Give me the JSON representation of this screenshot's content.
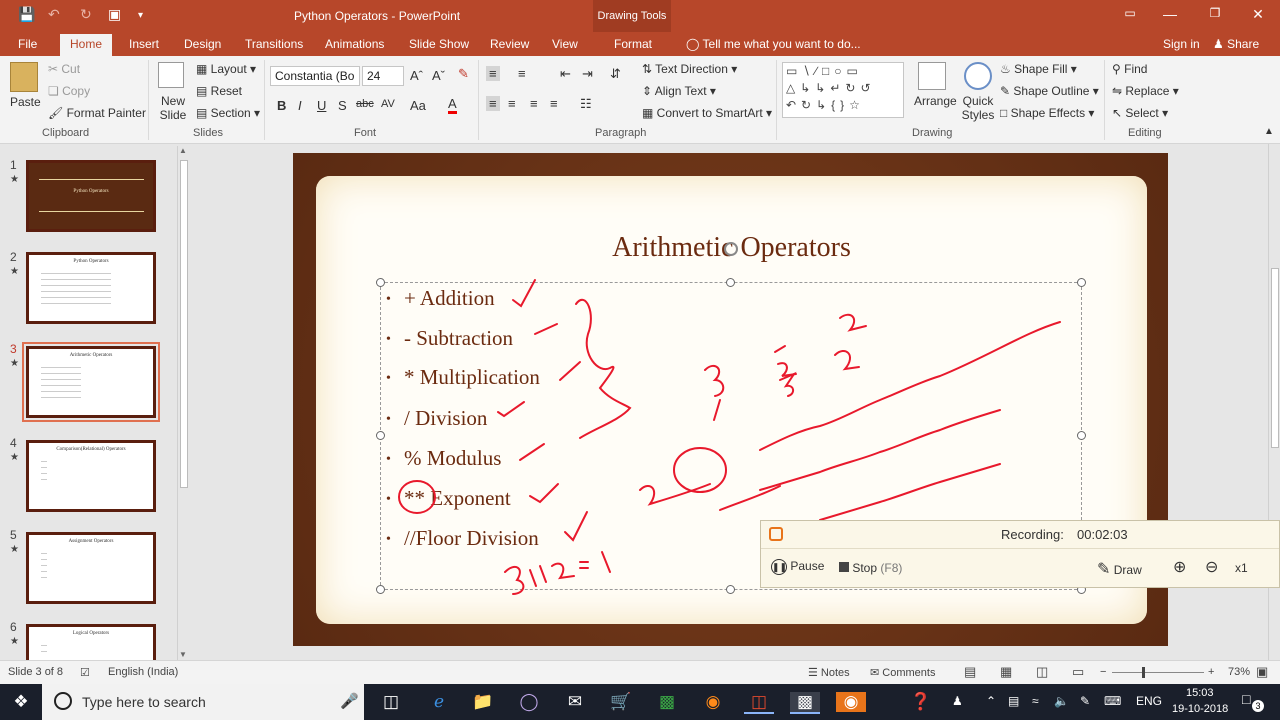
{
  "titlebar": {
    "title": "Python Operators - PowerPoint",
    "context_tab": "Drawing Tools"
  },
  "tabs": [
    "File",
    "Home",
    "Insert",
    "Design",
    "Transitions",
    "Animations",
    "Slide Show",
    "Review",
    "View",
    "Format"
  ],
  "tellme": "Tell me what you want to do...",
  "signin": "Sign in",
  "share": "Share",
  "ribbon": {
    "clipboard": {
      "paste": "Paste",
      "cut": "Cut",
      "copy": "Copy",
      "format_painter": "Format Painter",
      "label": "Clipboard"
    },
    "slides": {
      "new_slide": "New Slide",
      "layout": "Layout",
      "reset": "Reset",
      "section": "Section",
      "label": "Slides"
    },
    "font": {
      "name": "Constantia (Bo",
      "size": "24",
      "label": "Font"
    },
    "paragraph": {
      "text_direction": "Text Direction",
      "align_text": "Align Text",
      "convert_smartart": "Convert to SmartArt",
      "label": "Paragraph"
    },
    "drawing": {
      "arrange": "Arrange",
      "quick_styles": "Quick Styles",
      "shape_fill": "Shape Fill",
      "shape_outline": "Shape Outline",
      "shape_effects": "Shape Effects",
      "label": "Drawing"
    },
    "editing": {
      "find": "Find",
      "replace": "Replace",
      "select": "Select",
      "label": "Editing"
    }
  },
  "thumbnails": [
    {
      "num": "1",
      "title": "Python Operators",
      "selected": false,
      "dark": true
    },
    {
      "num": "2",
      "title": "Python Operators",
      "selected": false,
      "dark": false
    },
    {
      "num": "3",
      "title": "Arithmetic Operators",
      "selected": true,
      "dark": false
    },
    {
      "num": "4",
      "title": "Comparison(Relational) Operators",
      "selected": false,
      "dark": false
    },
    {
      "num": "5",
      "title": "Assignment Operators",
      "selected": false,
      "dark": false
    },
    {
      "num": "6",
      "title": "Logical Operators",
      "selected": false,
      "dark": false
    }
  ],
  "slide": {
    "title": "Arithmetic Operators",
    "bullets": [
      "+ Addition",
      "- Subtraction",
      "* Multiplication",
      "/ Division",
      "% Modulus",
      "** Exponent",
      "//Floor Division"
    ]
  },
  "recorder": {
    "recording_label": "Recording:",
    "time": "00:02:03",
    "pause": "Pause",
    "stop": "Stop",
    "stop_key": "(F8)",
    "draw": "Draw",
    "zoom_level": "x1"
  },
  "status": {
    "slide": "Slide 3 of 8",
    "language": "English (India)",
    "notes": "Notes",
    "comments": "Comments",
    "zoom": "73%"
  },
  "taskbar": {
    "search_placeholder": "Type here to search",
    "time": "15:03",
    "date": "19-10-2018",
    "lang": "ENG",
    "notif_count": "3"
  }
}
